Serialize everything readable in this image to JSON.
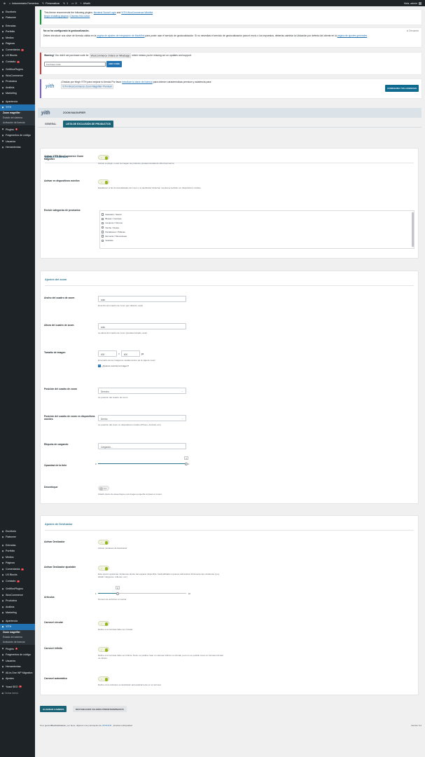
{
  "adminbar": {
    "site_name": "Indumentaria Femenina",
    "customizer": "Personalizar",
    "updates": "1",
    "comments": "0",
    "new": "Añadir",
    "greeting": "Hola, admin"
  },
  "sidebar": {
    "top_menu": [
      {
        "icon": "dashboard-icon",
        "label": "Escritorio"
      },
      {
        "icon": "flatsome-icon",
        "label": "Flatsome"
      },
      {
        "sep": true
      },
      {
        "icon": "pin-icon",
        "label": "Entradas"
      },
      {
        "icon": "portfolio-icon",
        "label": "Portfolio"
      },
      {
        "icon": "media-icon",
        "label": "Medios"
      },
      {
        "icon": "pages-icon",
        "label": "Páginas"
      },
      {
        "icon": "comments-icon",
        "label": "Comentarios",
        "badge": "1"
      },
      {
        "icon": "blocks-icon",
        "label": "UX Blocks"
      },
      {
        "icon": "mail-icon",
        "label": "Contacto",
        "badge": "1"
      },
      {
        "sep": true
      },
      {
        "icon": "getwoo-icon",
        "label": "GetWooPlugins"
      },
      {
        "icon": "woo-icon",
        "label": "WooCommerce"
      },
      {
        "icon": "products-icon",
        "label": "Productos"
      },
      {
        "icon": "analytics-icon",
        "label": "Análisis"
      },
      {
        "icon": "marketing-icon",
        "label": "Marketing"
      },
      {
        "sep": true
      },
      {
        "icon": "appearance-icon",
        "label": "Apariencia"
      },
      {
        "icon": "yith-icon",
        "label": "YITH",
        "active": true
      }
    ],
    "top_sub": [
      {
        "label": "Zoom magnifier",
        "current": true
      },
      {
        "label": "Estado del sistema"
      },
      {
        "label": "Activación de licencia"
      }
    ],
    "top_menu_after": [
      {
        "icon": "plugins-icon",
        "label": "Plugins",
        "badge": "1"
      },
      {
        "icon": "snippets-icon",
        "label": "Fragmentos de código"
      },
      {
        "icon": "users-icon",
        "label": "Usuarios"
      },
      {
        "icon": "tools-icon",
        "label": "Herramientas"
      }
    ],
    "bottom_menu": [
      {
        "icon": "dashboard-icon",
        "label": "Escritorio"
      },
      {
        "icon": "flatsome-icon",
        "label": "Flatsome"
      },
      {
        "sep": true
      },
      {
        "icon": "pin-icon",
        "label": "Entradas"
      },
      {
        "icon": "portfolio-icon",
        "label": "Portfolio"
      },
      {
        "icon": "media-icon",
        "label": "Medios"
      },
      {
        "icon": "pages-icon",
        "label": "Páginas"
      },
      {
        "icon": "comments-icon",
        "label": "Comentarios",
        "badge": "1"
      },
      {
        "icon": "blocks-icon",
        "label": "UX Blocks"
      },
      {
        "icon": "mail-icon",
        "label": "Contacto",
        "badge": "1"
      },
      {
        "sep": true
      },
      {
        "icon": "getwoo-icon",
        "label": "GetWooPlugins"
      },
      {
        "icon": "woo-icon",
        "label": "WooCommerce"
      },
      {
        "icon": "products-icon",
        "label": "Productos"
      },
      {
        "icon": "analytics-icon",
        "label": "Análisis"
      },
      {
        "icon": "marketing-icon",
        "label": "Marketing"
      },
      {
        "sep": true
      },
      {
        "icon": "appearance-icon",
        "label": "Apariencia"
      },
      {
        "icon": "yith-icon",
        "label": "YITH",
        "active": true
      }
    ],
    "bottom_sub": [
      {
        "label": "Zoom magnifier",
        "current": true
      },
      {
        "label": "Estado del sistema"
      },
      {
        "label": "Activación de licencia"
      }
    ],
    "bottom_menu_after": [
      {
        "icon": "plugins-icon",
        "label": "Plugins",
        "badge": "1"
      },
      {
        "icon": "snippets-icon",
        "label": "Fragmentos de código"
      },
      {
        "icon": "users-icon",
        "label": "Usuarios"
      },
      {
        "icon": "tools-icon",
        "label": "Herramientas"
      },
      {
        "icon": "migration-icon",
        "label": "All-in-One WP Migration"
      },
      {
        "icon": "settings-icon",
        "label": "Ajustes"
      },
      {
        "sep": true
      },
      {
        "icon": "seo-icon",
        "label": "Yoast SEO",
        "badge": "1"
      }
    ],
    "collapse_label": "Cerrar menú"
  },
  "notices": {
    "theme_plugins": {
      "text": "This theme recommends the following plugins:",
      "plugin1": "Nextend Social Login",
      "and": "and",
      "plugin2": "YITH WooCommerce Wishlist",
      "begin": "Begin installing plugins",
      "sep": "|",
      "dismiss": "Dismiss this notice"
    },
    "geo": {
      "title": "No se ha configurado la geolocalización.",
      "dismiss": "Descartar",
      "text": "Debes introducir una clave de licencia válida en la",
      "link": "página de ajustes de integración de MaxMind",
      "text2": "para poder usar el servicio de geolocalización. Si no necesitas el servicio de geolocalización para el envío o los impuestos, deberías cambiar la Ubicación por defecto del cliente en la",
      "link2": "página de ajustes generales",
      "end": "."
    },
    "purchase": {
      "strong": "Warning!",
      "text": "You didn't set purchase code for",
      "code": "WooCommerce Orders on Whatsapp",
      "text2": "which means you're missing out on updates and support.",
      "placeholder": "Purchase Code",
      "button": "ADD CODE"
    },
    "yith": {
      "text": "¡Gracias por elegir YITH para mejorar tu tienda! Por favor",
      "link": "introduce tu clave de licencia",
      "text2": "para obtener características premium y asistencia para:",
      "plugin": "YITH WooCommerce Zoom Magnifier Premium",
      "button": "CONFIGURA TUS LICENCIAS"
    }
  },
  "panel": {
    "logo": "yith",
    "title": "ZOOM MAGNIFIER",
    "tabs": [
      "GENERAL",
      "LISTA DE EXCLUSIÓN DE PRODUCTOS"
    ]
  },
  "general": {
    "title": "Ajustes Generales",
    "enable_label": "Activar YITH WooCommerce Zoom Magnifier",
    "enable_desc": "Activar el plugin o usar la imagen de producto predeterminada de WooCommerce.",
    "mobile_label": "Activar en dispositivos móviles",
    "mobile_desc": "Establecer si las funcionalidades del zoom y el deslizador deberían mostrarse también en dispositivos móviles.",
    "exclude_label": "Excluir categorías de productos",
    "categories": [
      "Sweaters / Sacos",
      "Blusas / Camisas",
      "Conjunto / Kimono",
      "Noche / Fiesta",
      "Pantalones / Polleras",
      "Remeras / Musculosas",
      "Vestidos"
    ]
  },
  "zoom": {
    "title": "Ajustes del zoom",
    "width_label": "Ancho del cuadro de zoom",
    "width_value": "auto",
    "width_desc": "El ancho del cuadro de zoom (por defecto: auto)",
    "height_label": "Altura del cuadro de zoom",
    "height_value": "auto",
    "height_desc": "La altura del cuadro de zoom (predeterminado: auto)",
    "size_label": "Tamaño de imagen",
    "size_w": "600",
    "size_x": "×",
    "size_h": "600",
    "size_unit": "px",
    "size_desc": "El tamaño de las imágenes usadas dentro de la caja de zoom",
    "crop_label": "¿Quieres recortar la imagen?",
    "position_label": "Posición del cuadro de zoom",
    "position_value": "Derecho",
    "position_desc": "La posición del cuadro de zoom",
    "mobile_pos_label": "Posición del cuadro de zoom en dispositivos móviles",
    "mobile_pos_value": "Dentro",
    "mobile_pos_desc": "La posición del zoom en dispositivos móviles (iPhone, Android, etc.)",
    "loading_label": "Etiqueta de cargando",
    "loading_value": "Cargando...",
    "opacity_label": "Opacidad de la tinte",
    "opacity_min": "0",
    "opacity_max": "1",
    "opacity_value": "1",
    "opacity_fraction": 1,
    "blur_label": "Desenfoque",
    "blur_toggle": "NO",
    "blur_desc": "Añadir efecto de desenfoque a la imagen pequeña al pasar el cursor."
  },
  "slider": {
    "title": "Ajustes de Deslizador",
    "enable_label": "Activar Deslizador",
    "enable_desc": "Activar miniatura de Deslizador.",
    "responsive_label": "Activar Deslizador ajustable",
    "responsive_desc": "Esta opción ajusta las miniaturas dentro del espacio disponible. Deshabilítala si quieres administrar libremente las miniaturas (p.ej. añadir márgenes, rellenos, etc.)",
    "items_label": "Artículos",
    "items_value": "3",
    "items_min": "1",
    "items_max": "10",
    "items_fraction": 0.22,
    "items_desc": "Número de artículos a mostrar",
    "circular_label": "Carrusel circular",
    "circular_desc": "Define si el carrusel debe ser circular.",
    "infinite_label": "Carrusel infinito",
    "infinite_desc": "Define si el carrusel debe ser infinito. Nota: es posible crear un carrusel infinito no circular, pero no es posible crear un carrusel circular no infinito.",
    "auto_label": "Carrusel automático",
    "auto_desc": "Define si los artículos se deslizarán automáticamente en el carrusel."
  },
  "actions": {
    "save": "GUARDAR CAMBIOS",
    "reset": "RESTABLECER VALORES PREDETERMINADOS"
  },
  "footer": {
    "text": "Si te gusta",
    "brand": "WooCommerce",
    "text2": ", por favor, déjanos una puntuación de",
    "stars": "★★★★★",
    "text3": ". ¡Gracias anticipadas!",
    "version": "Versión 6.2"
  },
  "colors": {
    "admin_dark": "#1d2327",
    "wp_blue": "#2271b1",
    "yith_teal": "#1a6377",
    "section_title": "#2a7590",
    "toggle_on": "#94b61f"
  }
}
